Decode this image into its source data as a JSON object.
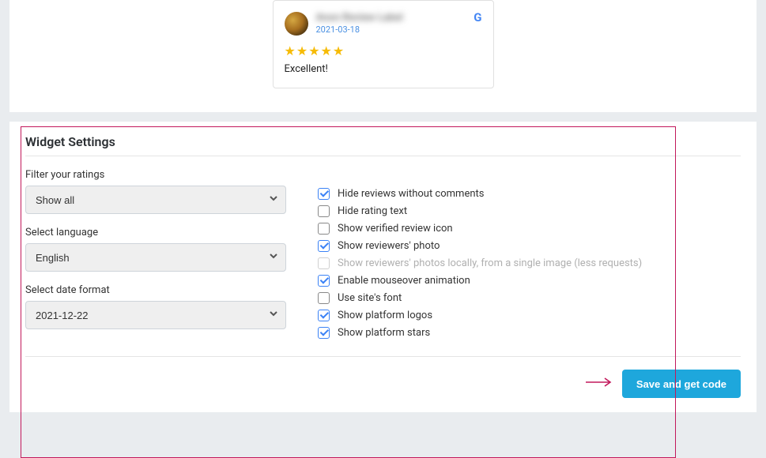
{
  "review": {
    "reviewer_name": "Anon Review Label",
    "date": "2021-03-18",
    "stars": "★★★★★",
    "text": "Excellent!"
  },
  "settings": {
    "title": "Widget Settings",
    "filter": {
      "label": "Filter your ratings",
      "value": "Show all"
    },
    "language": {
      "label": "Select language",
      "value": "English"
    },
    "date_format": {
      "label": "Select date format",
      "value": "2021-12-22"
    },
    "options": [
      {
        "label": "Hide reviews without comments",
        "checked": true,
        "disabled": false
      },
      {
        "label": "Hide rating text",
        "checked": false,
        "disabled": false
      },
      {
        "label": "Show verified review icon",
        "checked": false,
        "disabled": false
      },
      {
        "label": "Show reviewers' photo",
        "checked": true,
        "disabled": false
      },
      {
        "label": "Show reviewers' photos locally, from a single image (less requests)",
        "checked": false,
        "disabled": true
      },
      {
        "label": "Enable mouseover animation",
        "checked": true,
        "disabled": false
      },
      {
        "label": "Use site's font",
        "checked": false,
        "disabled": false
      },
      {
        "label": "Show platform logos",
        "checked": true,
        "disabled": false
      },
      {
        "label": "Show platform stars",
        "checked": true,
        "disabled": false
      }
    ],
    "save_button": "Save and get code"
  }
}
